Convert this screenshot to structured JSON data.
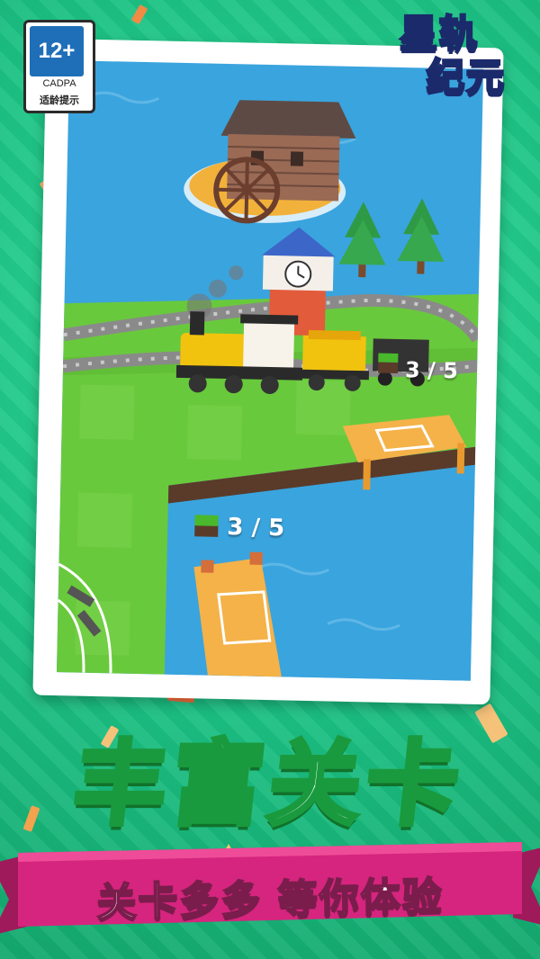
{
  "age_badge": {
    "rating": "12+",
    "org": "CADPA",
    "note": "适龄提示"
  },
  "logo": {
    "line1": "星轨",
    "line2": "纪元"
  },
  "counters": [
    {
      "value": "3 / 5"
    },
    {
      "value": "3 / 5"
    }
  ],
  "headline": "丰富关卡",
  "subheadline": "关卡多多 等你体验",
  "colors": {
    "background": "#1fc486",
    "water": "#3aa4de",
    "grass": "#69c93c",
    "headline_stroke": "#1a9a3e",
    "ribbon": "#d6257e"
  }
}
